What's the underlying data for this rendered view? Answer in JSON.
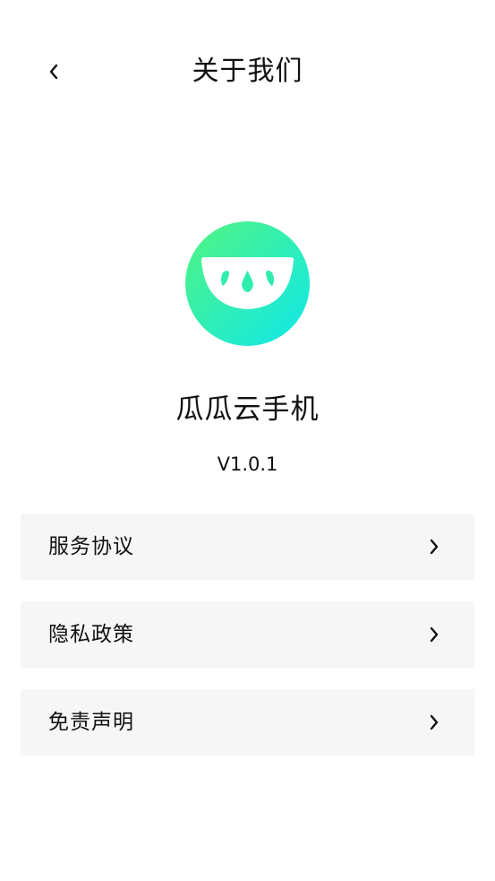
{
  "header": {
    "title": "关于我们",
    "back_icon": "chevron-left-icon"
  },
  "app": {
    "logo_icon": "watermelon-logo-icon",
    "name": "瓜瓜云手机",
    "version": "V1.0.1"
  },
  "menu": {
    "items": [
      {
        "label": "服务协议",
        "icon": "chevron-right-icon"
      },
      {
        "label": "隐私政策",
        "icon": "chevron-right-icon"
      },
      {
        "label": "免责声明",
        "icon": "chevron-right-icon"
      }
    ]
  },
  "colors": {
    "logo_gradient_start": "#4DF58A",
    "logo_gradient_end": "#12E8EA",
    "menu_background": "#F6F6F6",
    "text": "#111111"
  }
}
